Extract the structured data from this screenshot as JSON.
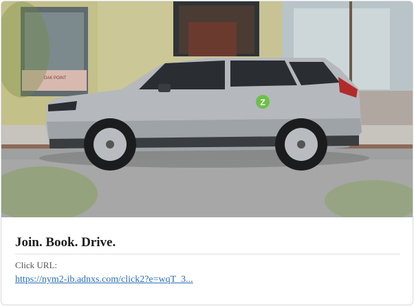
{
  "ad": {
    "headline": "Join. Book. Drive.",
    "click_url_label": "Click URL:",
    "click_url": "https://nym2-ib.adnxs.com/click2?e=wqT_3..."
  },
  "image": {
    "storefront_sign": "OAK POINT",
    "brand_logo_letter": "Z",
    "brand_color": "#6cc04a"
  }
}
